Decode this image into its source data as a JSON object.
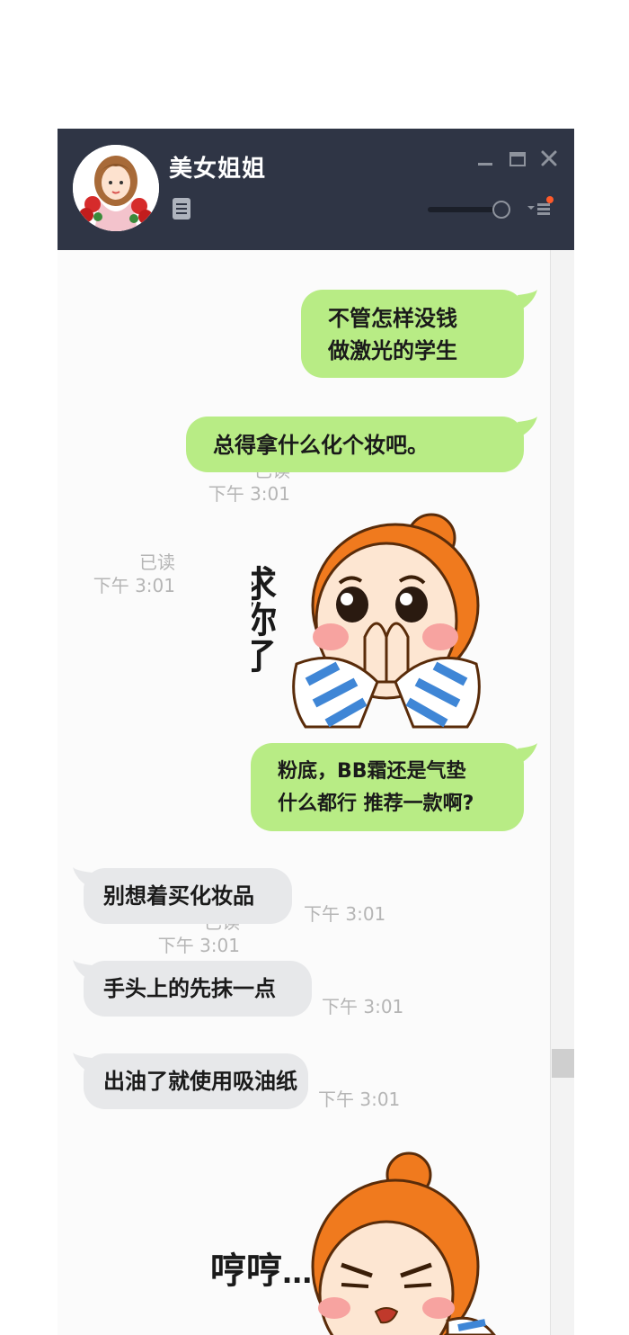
{
  "header": {
    "contact_name": "美女姐姐"
  },
  "messages": [
    {
      "direction": "sent",
      "lines": [
        "不管怎样没钱",
        "做激光的学生"
      ],
      "read": "已读",
      "time": "下午 3:01"
    },
    {
      "direction": "sent",
      "lines": [
        "总得拿什么化个妆吧。"
      ],
      "read": "已读",
      "time": "下午 3:01"
    },
    {
      "direction": "sent",
      "sticker": {
        "caption": "求你了"
      }
    },
    {
      "direction": "sent",
      "lines": [
        "粉底，BB霜还是气垫",
        "什么都行 推荐一款啊?"
      ],
      "read": "已读",
      "time": "下午 3:01"
    },
    {
      "direction": "received",
      "lines": [
        "别想着买化妆品"
      ],
      "time": "下午 3:01"
    },
    {
      "direction": "received",
      "lines": [
        "手头上的先抹一点"
      ],
      "time": "下午 3:01"
    },
    {
      "direction": "received",
      "lines": [
        "出油了就使用吸油纸"
      ],
      "time": "下午 3:01"
    },
    {
      "direction": "received",
      "sticker": {
        "caption": "哼哼..."
      }
    }
  ],
  "colors": {
    "titlebar": "#2f3545",
    "sent_bubble": "#b8ec85",
    "received_bubble": "#e7e8ea",
    "meta_text": "#b5b5b5",
    "sticker_hair": "#f07a1e",
    "sticker_stripe": "#3f86d6"
  },
  "icons": [
    "avatar",
    "doc-icon",
    "minimize-icon",
    "maximize-icon",
    "close-icon",
    "volume-slider",
    "menu-icon"
  ]
}
